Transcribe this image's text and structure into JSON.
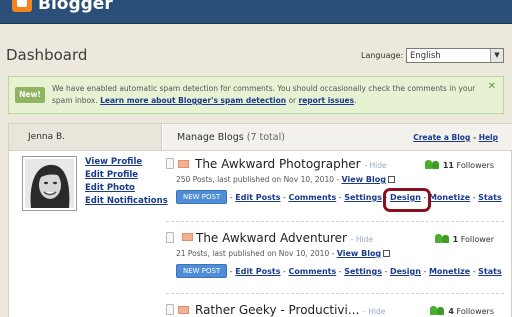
{
  "app": {
    "name": "Blogger"
  },
  "header": {
    "title": "Dashboard",
    "language_label": "Language:",
    "language_value": "English"
  },
  "notice": {
    "badge": "New!",
    "text_1": "We have enabled automatic spam detection for comments. You should occasionally check the comments in your spam inbox. ",
    "link_learn": "Learn more about Blogger's spam detection",
    "text_or": " or ",
    "link_report": "report issues",
    "text_end": ".",
    "close": "✕"
  },
  "profile": {
    "name": "Jenna B.",
    "links": [
      "View Profile",
      "Edit Profile",
      "Edit Photo",
      "Edit Notifications"
    ]
  },
  "manage": {
    "title": "Manage Blogs",
    "count": " (7 total)",
    "create_link": "Create a Blog",
    "help_link": "Help"
  },
  "blogs": [
    {
      "title": "The Awkward Photographer",
      "hide": "Hide",
      "followers_count": "11",
      "followers_label": "Followers",
      "meta": "250 Posts, last published on Nov 10, 2010 - ",
      "view_blog": "View Blog",
      "new_post": "NEW POST",
      "actions": [
        "Edit Posts",
        "Comments",
        "Settings",
        "Design",
        "Monetize",
        "Stats"
      ]
    },
    {
      "title": "The Awkward Adventurer",
      "hide": "Hide",
      "followers_count": "1",
      "followers_label": "Follower",
      "meta": "21 Posts, last published on Nov 10, 2010 - ",
      "view_blog": "View Blog",
      "new_post": "NEW POST",
      "actions": [
        "Edit Posts",
        "Comments",
        "Settings",
        "Design",
        "Monetize",
        "Stats"
      ]
    },
    {
      "title": "Rather Geeky - Productivi...",
      "hide": "Hide",
      "followers_count": "4",
      "followers_label": "Followers"
    }
  ],
  "colors": {
    "topbar": "#2a4f78",
    "link": "#1a3a8c",
    "highlight_ring": "#8a1020",
    "new_post": "#4f8ed6"
  }
}
